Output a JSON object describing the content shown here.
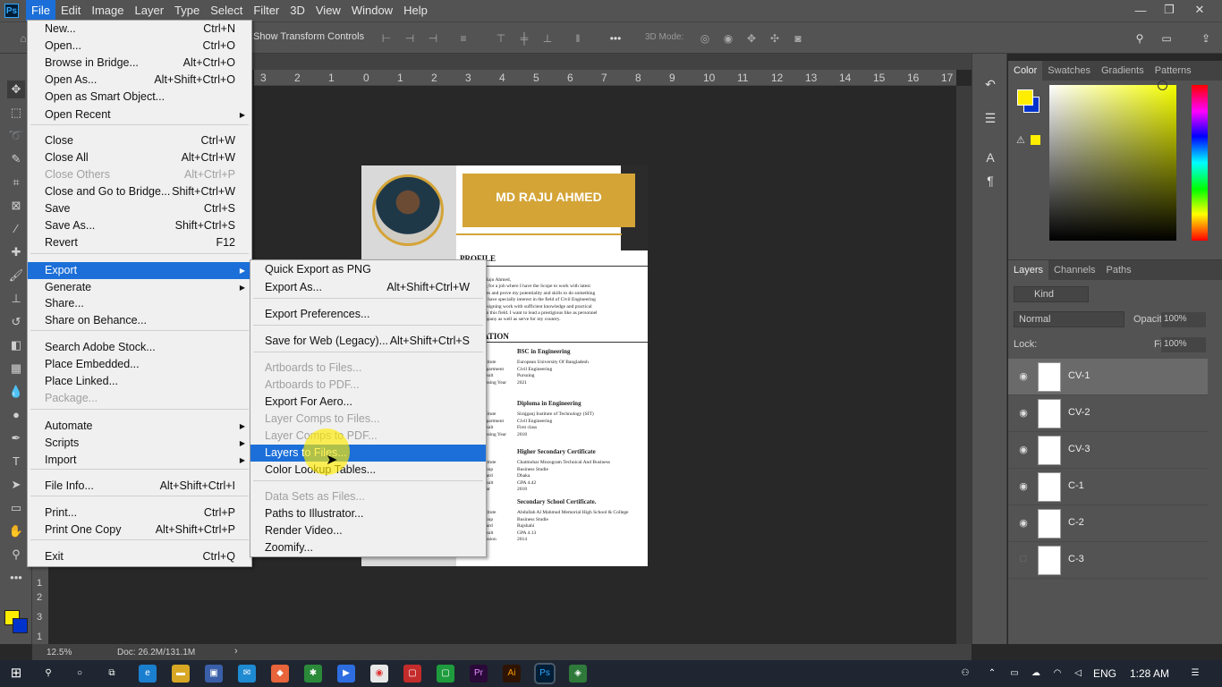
{
  "menubar": {
    "logo": "Ps",
    "items": [
      "File",
      "Edit",
      "Image",
      "Layer",
      "Type",
      "Select",
      "Filter",
      "3D",
      "View",
      "Window",
      "Help"
    ],
    "active": "File"
  },
  "options": {
    "show_transform": "Show Transform Controls",
    "mode3d": "3D Mode:"
  },
  "ruler_top": [
    "3",
    "2",
    "1",
    "0",
    "1",
    "2",
    "3",
    "4",
    "5",
    "6",
    "7",
    "8",
    "9",
    "10",
    "11",
    "12",
    "13",
    "14",
    "15",
    "16",
    "17"
  ],
  "ruler_left": [
    "1",
    "2",
    "3",
    "1"
  ],
  "status": {
    "zoom": "12.5%",
    "doc": "Doc: 26.2M/131.1M"
  },
  "document": {
    "name": "MD RAJU AHMED",
    "profile_heading": "PROFILE",
    "profile_lines": [
      "Raju Ahmed,",
      "g for a job where I have the Scope to work with latest",
      "les and prove my potentiality and skills to do something",
      "I have specially interest in the field of Civil Engineering",
      "esigning work with sufficient knowledge and practical",
      "in this field. I want to lead a prestigious like as personnel",
      "npany as well as serve for my country."
    ],
    "education_heading": "ATION",
    "blocks": [
      {
        "title": "BSC in Engineering",
        "labels": [
          "stitute",
          "epartment",
          "esult",
          "assing Year"
        ],
        "values": [
          "European University Of Bangladesh",
          "Civil Engineering",
          "Pursuing",
          "2021"
        ]
      },
      {
        "title": "Diploma in Engineering",
        "labels": [
          "stitute",
          "epartment",
          "esult",
          "assing Year"
        ],
        "values": [
          "Sirajganj Institute of Technology (SIT)",
          "Civil Engineering",
          "First class",
          "2018"
        ]
      },
      {
        "title": "Higher Secondary Certificate",
        "labels": [
          "stitute",
          "roup",
          "oard",
          "esult",
          "ear"
        ],
        "values": [
          "Chatmohar Mozogram Technical And Business",
          "Business Studie",
          "Dhaka",
          "GPA 4.42",
          "2018"
        ]
      },
      {
        "title": "Secondary School Certificate.",
        "labels": [
          "stitute",
          "roup",
          "oard",
          "esult",
          "assion"
        ],
        "values": [
          "Abdullah Al Mahmud Memorial High School & College",
          "Business Studie",
          "Rajshahi",
          "GPA 4.13",
          "2014"
        ]
      }
    ]
  },
  "file_menu": [
    {
      "label": "New...",
      "sc": "Ctrl+N"
    },
    {
      "label": "Open...",
      "sc": "Ctrl+O"
    },
    {
      "label": "Browse in Bridge...",
      "sc": "Alt+Ctrl+O"
    },
    {
      "label": "Open As...",
      "sc": "Alt+Shift+Ctrl+O"
    },
    {
      "label": "Open as Smart Object...",
      "sc": ""
    },
    {
      "label": "Open Recent",
      "sc": "",
      "sub": true
    },
    {
      "label": "Close",
      "sc": "Ctrl+W"
    },
    {
      "label": "Close All",
      "sc": "Alt+Ctrl+W"
    },
    {
      "label": "Close Others",
      "sc": "Alt+Ctrl+P",
      "dis": true
    },
    {
      "label": "Close and Go to Bridge...",
      "sc": "Shift+Ctrl+W"
    },
    {
      "label": "Save",
      "sc": "Ctrl+S"
    },
    {
      "label": "Save As...",
      "sc": "Shift+Ctrl+S"
    },
    {
      "label": "Revert",
      "sc": "F12"
    },
    {
      "label": "Export",
      "sc": "",
      "sub": true,
      "hl": true
    },
    {
      "label": "Generate",
      "sc": "",
      "sub": true
    },
    {
      "label": "Share...",
      "sc": ""
    },
    {
      "label": "Share on Behance...",
      "sc": ""
    },
    {
      "label": "Search Adobe Stock...",
      "sc": ""
    },
    {
      "label": "Place Embedded...",
      "sc": ""
    },
    {
      "label": "Place Linked...",
      "sc": ""
    },
    {
      "label": "Package...",
      "sc": "",
      "dis": true
    },
    {
      "label": "Automate",
      "sc": "",
      "sub": true
    },
    {
      "label": "Scripts",
      "sc": "",
      "sub": true
    },
    {
      "label": "Import",
      "sc": "",
      "sub": true
    },
    {
      "label": "File Info...",
      "sc": "Alt+Shift+Ctrl+I"
    },
    {
      "label": "Print...",
      "sc": "Ctrl+P"
    },
    {
      "label": "Print One Copy",
      "sc": "Alt+Shift+Ctrl+P"
    },
    {
      "label": "Exit",
      "sc": "Ctrl+Q"
    }
  ],
  "export_menu": [
    {
      "label": "Quick Export as PNG",
      "sc": ""
    },
    {
      "label": "Export As...",
      "sc": "Alt+Shift+Ctrl+W"
    },
    {
      "label": "Export Preferences...",
      "sc": ""
    },
    {
      "label": "Save for Web (Legacy)...",
      "sc": "Alt+Shift+Ctrl+S"
    },
    {
      "label": "Artboards to Files...",
      "sc": "",
      "dis": true
    },
    {
      "label": "Artboards to PDF...",
      "sc": "",
      "dis": true
    },
    {
      "label": "Export For Aero...",
      "sc": ""
    },
    {
      "label": "Layer Comps to Files...",
      "sc": "",
      "dis": true
    },
    {
      "label": "Layer Comps to PDF...",
      "sc": "",
      "dis": true
    },
    {
      "label": "Layers to Files...",
      "sc": "",
      "hl": true
    },
    {
      "label": "Color Lookup Tables...",
      "sc": ""
    },
    {
      "label": "Data Sets as Files...",
      "sc": "",
      "dis": true
    },
    {
      "label": "Paths to Illustrator...",
      "sc": ""
    },
    {
      "label": "Render Video...",
      "sc": ""
    },
    {
      "label": "Zoomify...",
      "sc": ""
    }
  ],
  "color_panel": {
    "tabs": [
      "Color",
      "Swatches",
      "Gradients",
      "Patterns"
    ],
    "fg": "#ffee00",
    "bg": "#0033cc"
  },
  "layers_panel": {
    "tabs": [
      "Layers",
      "Channels",
      "Paths"
    ],
    "kind": "Kind",
    "blend": "Normal",
    "opacity_label": "Opacity:",
    "opacity": "100%",
    "lock_label": "Lock:",
    "fill_label": "Fill:",
    "fill": "100%",
    "layers": [
      {
        "name": "CV-1",
        "visible": true,
        "selected": true
      },
      {
        "name": "CV-2",
        "visible": true
      },
      {
        "name": "CV-3",
        "visible": true
      },
      {
        "name": "C-1",
        "visible": true
      },
      {
        "name": "C-2",
        "visible": true
      },
      {
        "name": "C-3",
        "visible": false
      }
    ]
  },
  "taskbar": {
    "lang": "ENG",
    "time": "1:28 AM"
  }
}
